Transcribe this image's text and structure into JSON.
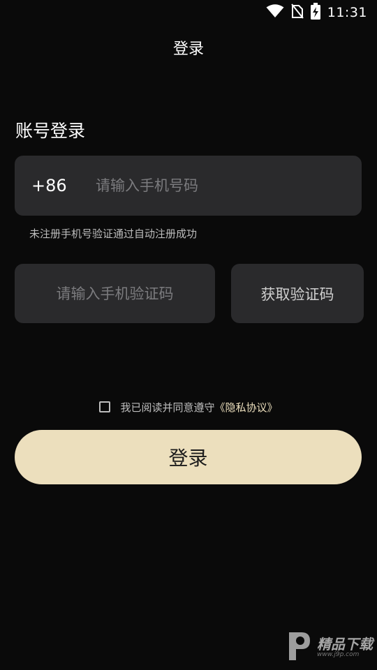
{
  "status_bar": {
    "time": "11:31",
    "icons": [
      "wifi-icon",
      "no-sim-icon",
      "battery-charging-icon"
    ]
  },
  "header": {
    "title": "登录"
  },
  "login_form": {
    "heading": "账号登录",
    "country_code": "+86",
    "phone_placeholder": "请输入手机号码",
    "hint": "未注册手机号验证通过自动注册成功",
    "code_placeholder": "请输入手机验证码",
    "get_code_label": "获取验证码",
    "agreement_text": "我已阅读并同意遵守",
    "privacy_link": "《隐私协议》",
    "agreement_checked": false,
    "login_label": "登录"
  },
  "watermark": {
    "brand": "精品下载",
    "url": "www.j9p.com"
  },
  "colors": {
    "background": "#0a0a0a",
    "field": "#2a2a2c",
    "accent": "#ecdfbd"
  }
}
